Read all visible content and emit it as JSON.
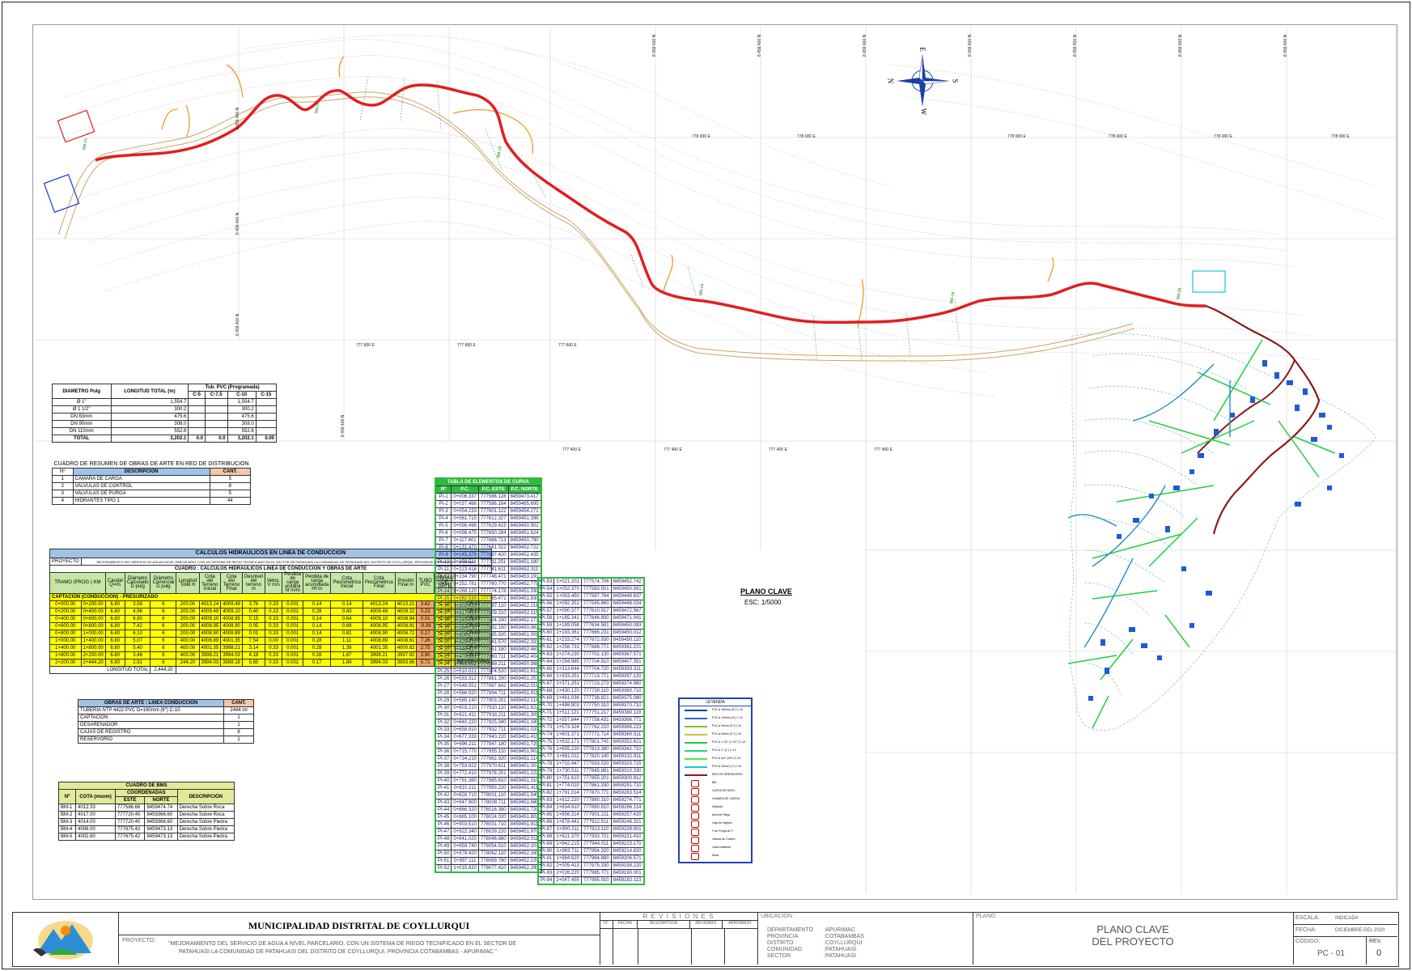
{
  "map": {
    "north_label": "N",
    "south_label": "S",
    "east_label": "E",
    "west_label": "W",
    "north_coords_top": [
      "8 459 400 N",
      "8 459 400 N",
      "8 459 400 N",
      "8 459 400 N",
      "8 459 400 N",
      "8 459 400 N",
      "8 459 400 N"
    ],
    "north_coords_left": [
      "8 459 400 N",
      "8 459 400 N",
      "8 459 400 N",
      "8 459 400 N"
    ],
    "east_coords_top": [
      "778 000 E",
      "778 000 E",
      "778 000 E",
      "778 000 E",
      "778 000 E",
      "778 000 E"
    ],
    "east_coords_mid": [
      "777 800 E",
      "777 800 E",
      "777 800 E"
    ],
    "east_coords_low": [
      "777 400 E",
      "777 400 E",
      "777 400 E",
      "777 400 E"
    ],
    "plano_clave_title": "PLANO CLAVE",
    "plano_clave_scale": "ESC: 1/5000",
    "bm_labels": [
      "BM-01",
      "BM-02",
      "BM-03",
      "BM-04",
      "BM-05",
      "BM-06"
    ]
  },
  "diam_table": {
    "headers": [
      "DIAMETRO Pulg",
      "LONGITUD TOTAL (m)",
      "Tub. PVC (Programada)",
      "C-5",
      "C-7.5",
      "C-10",
      "C-15"
    ],
    "rows": [
      [
        "Ø 1\"",
        "1,554.7",
        "",
        "",
        "1,554.7",
        ""
      ],
      [
        "Ø 1 1/2\"",
        "300.2",
        "",
        "",
        "300.2",
        ""
      ],
      [
        "DN 63mm",
        "475.6",
        "",
        "",
        "475.6",
        ""
      ],
      [
        "DN 90mm",
        "308.0",
        "",
        "",
        "308.0",
        ""
      ],
      [
        "DN 110mm",
        "552.6",
        "",
        "",
        "552.6",
        ""
      ],
      [
        "TOTAL",
        "3,202.1",
        "0.0",
        "0.0",
        "3,202.1",
        "0.00"
      ]
    ]
  },
  "obras_red": {
    "title": "CUADRO DE RESUMEN DE OBRAS DE ARTE EN RED DE DISTRIBUCION",
    "h_n": "Nº",
    "h_desc": "DESCRIPCION",
    "h_cant": "CANT.",
    "rows": [
      {
        "n": "1",
        "desc": "CAMARA DE CARGA",
        "cant": "5"
      },
      {
        "n": "2",
        "desc": "VALVULAS DE CONTROL",
        "cant": "8"
      },
      {
        "n": "3",
        "desc": "VALVULAS DE PURGA",
        "cant": "5"
      },
      {
        "n": "4",
        "desc": "HIDRANTES TIPO 1",
        "cant": "44"
      }
    ]
  },
  "hydraulic": {
    "title": "CALCULOS HIDRAULICOS EN LINEA DE CONDUCCION",
    "proyecto_label": "PROYECTO",
    "proyecto_text": "\"MEJORAMIENTO DEL SERVICIO DE AGUA A NIVEL PARCELARIO, CON UN SISTEMA DE RIEGO TECNIFICADO EN EL SECTOR DE PATAHUASI LA COMUNIDAD DE PATAHUASI DEL DISTRITO DE COYLLURQUI, PROVINCIA COTABAMBAS - APURIMAC\"",
    "subtitle": "CUADRO : CALCULOS HIDRAULICOS LINEA DE CONDUCCION Y OBRAS DE ARTE",
    "headers": [
      "TRAMO (PROG.) KM",
      "Caudal Q=l/s",
      "Diámetro Calculado D pulg",
      "Diámetro Comercial D pulg",
      "Longitud Total m",
      "Cota del Terreno Inicial",
      "Cota del Terreno Final",
      "Desnivel del terreno m",
      "Veloc. V m/s",
      "Pérdida de carga unitaria hf m/m",
      "Pérdida de carga acumulada Hf m",
      "Cota Piezométrica Inicial",
      "Cota Piezométrica Final",
      "Presión Final m",
      "TUBO PVC",
      "OBRAS DE ARTE"
    ],
    "captacion": "CAPTACION (CONDUCCION) - PRESURIZADO",
    "rows": [
      [
        "0+000.00",
        "0+200.00",
        "6.80",
        "3.58",
        "6",
        "200.00",
        "4013.24",
        "4009.49",
        "3.76",
        "0.33",
        "0.001",
        "0.14",
        "0.14",
        "4013.24",
        "4013.21",
        "3.62",
        "C-10",
        "CR-01"
      ],
      [
        "0+200.00",
        "0+400.00",
        "6.80",
        "4.96",
        "6",
        "200.00",
        "4009.49",
        "4009.10",
        "0.40",
        "0.33",
        "0.001",
        "0.28",
        "0.43",
        "4009.49",
        "4009.32",
        "0.23",
        "C-10",
        "CR-02"
      ],
      [
        "0+400.00",
        "0+600.00",
        "6.80",
        "6.80",
        "6",
        "200.00",
        "4009.10",
        "4008.95",
        "0.15",
        "0.33",
        "0.001",
        "0.14",
        "0.64",
        "4009.10",
        "4008.94",
        "0.01",
        "C-10",
        "CR-03"
      ],
      [
        "0+600.00",
        "0+800.00",
        "6.80",
        "7.42",
        "6",
        "200.00",
        "4008.95",
        "4008.90",
        "0.05",
        "0.33",
        "0.001",
        "0.14",
        "0.69",
        "4008.95",
        "4008.81",
        "-0.09",
        "C-10",
        "CR-04"
      ],
      [
        "0+800.00",
        "1+000.00",
        "6.80",
        "6.10",
        "6",
        "200.00",
        "4008.90",
        "4008.89",
        "0.01",
        "0.33",
        "0.001",
        "0.14",
        "0.82",
        "4008.90",
        "4008.72",
        "0.17",
        "C-10",
        "CR-05"
      ],
      [
        "1+000.00",
        "1+400.00",
        "6.80",
        "5.07",
        "6",
        "400.00",
        "4008.89",
        "4001.35",
        "7.54",
        "0.00",
        "0.001",
        "0.28",
        "1.11",
        "4008.89",
        "4008.61",
        "7.26",
        "C-10",
        "CR-06"
      ],
      [
        "1+400.00",
        "1+800.00",
        "6.80",
        "5.40",
        "6",
        "400.00",
        "4001.35",
        "3998.21",
        "3.14",
        "0.33",
        "0.001",
        "0.28",
        "1.39",
        "4001.35",
        "4000.82",
        "2.75",
        "C-10",
        "CR-07"
      ],
      [
        "1+800.00",
        "2+200.00",
        "6.80",
        "3.46",
        "6",
        "400.00",
        "3998.21",
        "3994.03",
        "4.18",
        "0.33",
        "0.001",
        "0.28",
        "1.67",
        "3998.21",
        "3997.92",
        "3.90",
        "C-10",
        "CR-08"
      ],
      [
        "2+200.00",
        "2+444.20",
        "6.80",
        "2.91",
        "6",
        "244.20",
        "3994.03",
        "3988.18",
        "5.85",
        "0.33",
        "0.001",
        "0.17",
        "1.84",
        "3994.03",
        "3993.86",
        "5.71",
        "C-10",
        "RESERVORIO"
      ]
    ],
    "total_label": "LONGITUD TOTAL",
    "total_value": "2,444.20"
  },
  "obras_cond": {
    "title": "OBRAS DE ARTE : LINEA CONDUCCION",
    "h_cant": "CANT.",
    "rows": [
      {
        "desc": "TUBERIA NTP 4422 PVC D=160mm (6\") C-10",
        "cant": "2444 ml"
      },
      {
        "desc": "CAPTACION",
        "cant": "1"
      },
      {
        "desc": "DESARENADOR",
        "cant": "1"
      },
      {
        "desc": "CAJAS DE REGISTRO",
        "cant": "8"
      },
      {
        "desc": "RESERVORIO",
        "cant": "1"
      }
    ]
  },
  "bms": {
    "title": "CUADRO DE BMS",
    "headers": [
      "Nº",
      "COTA (msnm)",
      "COORDENADAS",
      "ESTE",
      "NORTE",
      "DESCRIPCIÓN"
    ],
    "rows": [
      [
        "BM-1",
        "4012.33",
        "777586.66",
        "8459474.74",
        "Derecha Sobre Roca"
      ],
      [
        "BM-2",
        "4017.00",
        "777720.40",
        "8459366.60",
        "Derecha Sobre Roca"
      ],
      [
        "BM-3",
        "4014.00",
        "777720.40",
        "8459368.60",
        "Derecha Sobre Piedra"
      ],
      [
        "BM-4",
        "4006.00",
        "777675.42",
        "8459473.13",
        "Derecha Sobre Piedra"
      ],
      [
        "BM-5",
        "4002.60",
        "777675.42",
        "8459473.13",
        "Derecha Sobre Piedra"
      ]
    ]
  },
  "curve_table": {
    "title": "TABLA DE ELEMENTOS DE CURVA",
    "headers": [
      "Nº",
      "P.C.",
      "P.C. ESTE",
      "P.C. NORTE"
    ],
    "rows_left": [
      [
        "PI-1",
        "0+006.337",
        "777586.128",
        "8459473.417"
      ],
      [
        "PI-2",
        "0+037.466",
        "777586.164",
        "8459465.695"
      ],
      [
        "PI-3",
        "0+054.233",
        "777601.122",
        "8459454.271"
      ],
      [
        "PI-4",
        "0+081.715",
        "777612.327",
        "8459451.396"
      ],
      [
        "PI-5",
        "0+098.496",
        "777629.415",
        "8459450.902"
      ],
      [
        "PI-6",
        "0+098.475",
        "777650.284",
        "8459451.624"
      ],
      [
        "PI-7",
        "0+117.401",
        "777668.713",
        "8459450.790"
      ],
      [
        "PI-8",
        "0+131.470",
        "777681.322",
        "8459452.722"
      ],
      [
        "PI-9",
        "0+145.378",
        "777697.420",
        "8459452.435"
      ],
      [
        "PI-10",
        "0+159.511",
        "777711.251",
        "8459451.180"
      ],
      [
        "PI-11",
        "0+223.418",
        "777741.611",
        "8459452.311"
      ],
      [
        "PI-12",
        "0+234.790",
        "777748.471",
        "8459453.191"
      ],
      [
        "PI-13",
        "0+252.781",
        "777760.770",
        "8459452.779"
      ],
      [
        "PI-14",
        "0+268.120",
        "777774.178",
        "8459451.330"
      ],
      [
        "PI-15",
        "0+282.533",
        "777785.471",
        "8459451.830"
      ],
      [
        "PI-16",
        "0+302.623",
        "777797.110",
        "8459452.218"
      ],
      [
        "PI-17",
        "0+317.351",
        "777809.210",
        "8459452.115"
      ],
      [
        "PI-18",
        "0+345.240",
        "777824.330",
        "8459452.271"
      ],
      [
        "PI-19",
        "0+384.730",
        "777832.150",
        "8459450.982"
      ],
      [
        "PI-20",
        "0+406.277",
        "777835.920",
        "8459451.008"
      ],
      [
        "PI-21",
        "0+425.211",
        "777841.570",
        "8459452.331"
      ],
      [
        "PI-22",
        "0+446.917",
        "777851.180",
        "8459452.461"
      ],
      [
        "PI-23",
        "0+470.381",
        "777860.711",
        "8459452.404"
      ],
      [
        "PI-24",
        "0+491.552",
        "777868.211",
        "8459450.988"
      ],
      [
        "PI-25",
        "0+510.021",
        "777874.520",
        "8459451.612"
      ],
      [
        "PI-26",
        "0+533.312",
        "777881.330",
        "8459451.257"
      ],
      [
        "PI-27",
        "0+548.551",
        "777887.641",
        "8459452.019"
      ],
      [
        "PI-28",
        "0+566.920",
        "777894.711",
        "8459451.811"
      ],
      [
        "PI-29",
        "0+585.140",
        "777903.201",
        "8459452.114"
      ],
      [
        "PI-30",
        "0+603.210",
        "777910.110",
        "8459451.622"
      ],
      [
        "PI-31",
        "0+621.411",
        "777918.211",
        "8459451.309"
      ],
      [
        "PI-32",
        "0+640.220",
        "777925.340",
        "8459451.180"
      ],
      [
        "PI-33",
        "0+658.910",
        "777932.711",
        "8459451.020"
      ],
      [
        "PI-34",
        "0+677.333",
        "777940.220",
        "8459451.410"
      ],
      [
        "PI-35",
        "0+696.211",
        "777947.180",
        "8459451.720"
      ],
      [
        "PI-36",
        "0+715.770",
        "777955.110",
        "8459451.902"
      ],
      [
        "PI-37",
        "0+734.210",
        "777962.920",
        "8459451.114"
      ],
      [
        "PI-38",
        "0+753.922",
        "777970.611",
        "8459451.007"
      ],
      [
        "PI-39",
        "0+772.410",
        "777978.201",
        "8459451.222"
      ],
      [
        "PI-40",
        "0+791.380",
        "777985.610",
        "8459451.310"
      ],
      [
        "PI-41",
        "0+810.211",
        "777993.220",
        "8459451.411"
      ],
      [
        "PI-42",
        "0+828.710",
        "778001.110",
        "8459451.540"
      ],
      [
        "PI-43",
        "0+847.900",
        "778008.711",
        "8459451.680"
      ],
      [
        "PI-44",
        "0+866.320",
        "778016.380",
        "8459451.720"
      ],
      [
        "PI-45",
        "0+885.100",
        "778024.020",
        "8459451.802"
      ],
      [
        "PI-46",
        "0+903.510",
        "778031.710",
        "8459451.911"
      ],
      [
        "PI-47",
        "0+922.340",
        "778039.220",
        "8459451.970"
      ],
      [
        "PI-48",
        "0+941.020",
        "778046.880",
        "8459452.011"
      ],
      [
        "PI-49",
        "0+959.740",
        "778054.510",
        "8459452.101"
      ],
      [
        "PI-50",
        "0+978.420",
        "778062.110",
        "8459452.160"
      ],
      [
        "PI-51",
        "0+997.111",
        "778069.780",
        "8459452.220"
      ],
      [
        "PI-52",
        "1+015.820",
        "778077.410",
        "8459452.290"
      ]
    ],
    "rows_right": [
      [
        "PI-53",
        "1+021.201",
        "777574.706",
        "8459452.742"
      ],
      [
        "PI-54",
        "1+052.370",
        "777583.501",
        "8459450.561"
      ],
      [
        "PI-55",
        "1+083.450",
        "777587.784",
        "8459449.837"
      ],
      [
        "PI-56",
        "1+092.351",
        "777595.860",
        "8459448.024"
      ],
      [
        "PI-57",
        "1+090.377",
        "777610.917",
        "8459472.567"
      ],
      [
        "PI-58",
        "1+165.341",
        "777646.800",
        "8459471.941"
      ],
      [
        "PI-59",
        "1+189.058",
        "777634.581",
        "8459450.093"
      ],
      [
        "PI-60",
        "1+193.361",
        "777666.231",
        "8459450.012"
      ],
      [
        "PI-61",
        "1+233.274",
        "777672.930",
        "8459450.110"
      ],
      [
        "PI-62",
        "1+258.731",
        "777688.771",
        "8459361.221"
      ],
      [
        "PI-63",
        "1+274.230",
        "777702.130",
        "8459367.571"
      ],
      [
        "PI-64",
        "1+294.985",
        "777704.810",
        "8459407.351"
      ],
      [
        "PI-65",
        "1+313.644",
        "777704.720",
        "8459393.311"
      ],
      [
        "PI-66",
        "1+333.251",
        "777713.771",
        "8459397.120"
      ],
      [
        "PI-67",
        "1+371.251",
        "777723.273",
        "8459374.980"
      ],
      [
        "PI-68",
        "1+430.120",
        "777730.110",
        "8459380.710"
      ],
      [
        "PI-69",
        "1+461.038",
        "777738.821",
        "8459375.080"
      ],
      [
        "PI-70",
        "1+486.903",
        "777750.310",
        "8459370.710"
      ],
      [
        "PI-71",
        "1+511.121",
        "777751.217",
        "8459380.118"
      ],
      [
        "PI-72",
        "1+557.844",
        "777758.431",
        "8459366.771"
      ],
      [
        "PI-73",
        "1+573.324",
        "777762.210",
        "8459366.223"
      ],
      [
        "PI-74",
        "1+601.371",
        "777772.714",
        "8459360.511"
      ],
      [
        "PI-75",
        "1+632.171",
        "777801.741",
        "8459352.621"
      ],
      [
        "PI-76",
        "1+655.220",
        "777813.380",
        "8459342.710"
      ],
      [
        "PI-77",
        "1+681.011",
        "777820.140",
        "8459332.911"
      ],
      [
        "PI-78",
        "1+702.447",
        "777833.020",
        "8459320.715"
      ],
      [
        "PI-79",
        "1+730.511",
        "777845.881",
        "8459310.330"
      ],
      [
        "PI-80",
        "1+751.610",
        "777855.201",
        "8459300.812"
      ],
      [
        "PI-81",
        "1+774.020",
        "777861.330",
        "8459291.710"
      ],
      [
        "PI-82",
        "1+791.014",
        "777870.771",
        "8459283.514"
      ],
      [
        "PI-83",
        "1+812.220",
        "777880.310",
        "8459274.771"
      ],
      [
        "PI-84",
        "1+834.910",
        "777890.810",
        "8459266.114"
      ],
      [
        "PI-85",
        "1+856.314",
        "777901.211",
        "8459257.420"
      ],
      [
        "PI-86",
        "1+878.441",
        "777912.511",
        "8459248.321"
      ],
      [
        "PI-87",
        "1+900.211",
        "777923.110",
        "8459239.801"
      ],
      [
        "PI-88",
        "1+921.370",
        "777933.701",
        "8459231.410"
      ],
      [
        "PI-89",
        "1+942.215",
        "777944.011",
        "8459223.170"
      ],
      [
        "PI-90",
        "1+963.711",
        "777954.320",
        "8459214.820"
      ],
      [
        "PI-91",
        "1+984.620",
        "777964.880",
        "8459206.571"
      ],
      [
        "PI-92",
        "2+005.413",
        "777975.330",
        "8459198.220"
      ],
      [
        "PI-93",
        "2+026.220",
        "777985.771",
        "8459190.001"
      ],
      [
        "PI-94",
        "2+047.455",
        "777995.910",
        "8459182.113"
      ]
    ]
  },
  "legend": {
    "title": "LEYENDA",
    "items": [
      "PVC ø 160mm (6\") C-10",
      "PVC ø 110mm (4\") C-10",
      "PVC ø 90mm (3\") C-10",
      "PVC ø 63mm (2\") C-10",
      "PVC ø 1 1/2\" (1 1/2\") C-10",
      "PVC ø 1\" (1\") C-10",
      "PVC ø 3/4\" (3/4\") C-10",
      "PVC ø 32mm (1\") C-10",
      "RED DE RESERVORIO",
      "BM",
      "CURVA DE NIVEL",
      "CAMARA DE CARGA",
      "Hidrante",
      "Area de Riego",
      "Caja de registro",
      "V de Purga de 1\"",
      "Valvula de Control",
      "Casa existente",
      "Nodo"
    ]
  },
  "title_block": {
    "institution": "MUNICIPALIDAD DISTRITAL DE COYLLURQUI",
    "proyecto_label": "PROYECTO:",
    "proyecto_line1": "\"MEJORAMIENTO DEL SERVICIO DE AGUA A NIVEL PARCELARIO, CON UN SISTEMA DE RIEGO TECNIFICADO EN EL SECTOR DE",
    "proyecto_line2": "PATAHUASI LA COMUNIDAD DE PATAHUASI DEL DISTRITO DE COYLLURQUI, PROVINCIA COTABAMBAS - APURIMAC \"",
    "revisiones": "R E V I S I O N E S",
    "rev_headers": [
      "Nº",
      "FECHA",
      "DESCRIPCIÓN",
      "REVISADO",
      "APROBADO"
    ],
    "ubicacion_label": "UBICACION :",
    "ubicacion_keys": [
      "DEPARTAMENTO",
      "PROVINCIA",
      "DISTRITO",
      "COMUNIDAD",
      "SECTOR"
    ],
    "ubicacion_vals": [
      ":APURIMAC",
      ":COTABAMBAS",
      ":COYLLURQUI",
      ":PATAHUASI",
      ":PATAHUASI"
    ],
    "plano_label": "PLANO:",
    "plano_line1": "PLANO CLAVE",
    "plano_line2": "DEL PROYECTO",
    "escala_label": "ESCALA:",
    "escala_val": "INDICADA",
    "fecha_label": "FECHA:",
    "fecha_val": "DICIEMBRE DEL 2020",
    "codigo_label": "CODIGO:",
    "codigo_val": "PC - 01",
    "rev_label": "REV.",
    "rev_val": "0"
  }
}
